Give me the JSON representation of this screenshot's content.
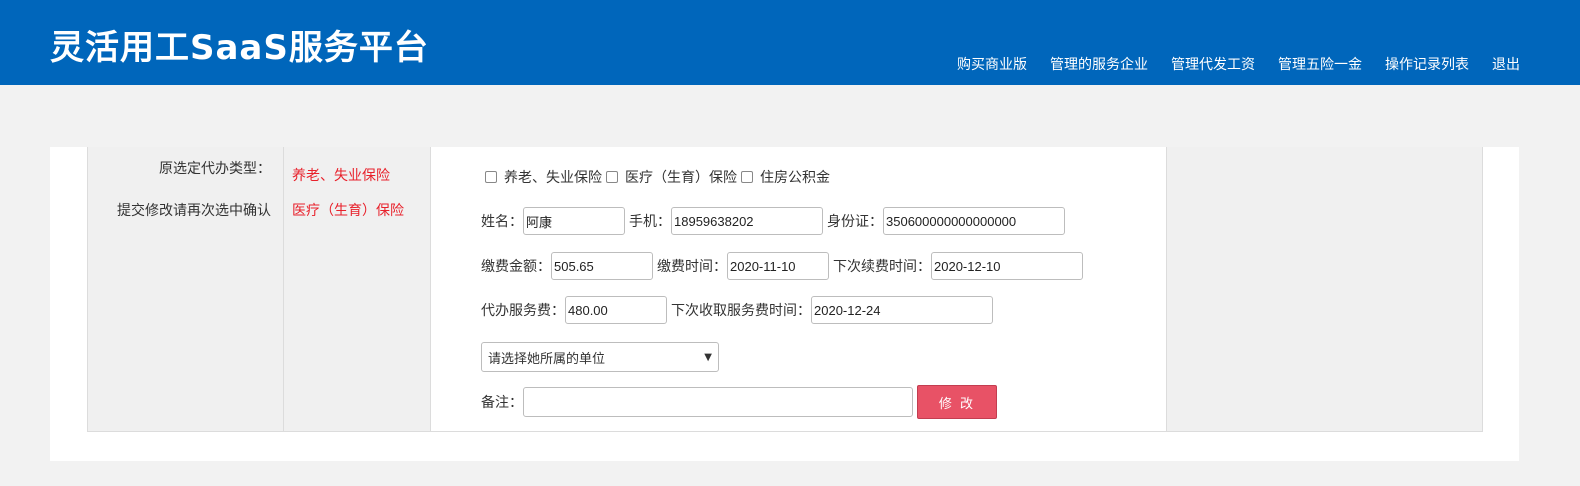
{
  "header": {
    "title": "灵活用工SaaS服务平台",
    "nav": [
      "购买商业版",
      "管理的服务企业",
      "管理代发工资",
      "管理五险一金",
      "操作记录列表",
      "退出"
    ]
  },
  "left": {
    "label1": "原选定代办类型：",
    "label2": "提交修改请再次选中确认"
  },
  "original_types": [
    "养老、失业保险",
    "医疗（生育）保险"
  ],
  "form": {
    "checkboxes": [
      "养老、失业保险",
      "医疗（生育）保险",
      "住房公积金"
    ],
    "name_label": "姓名：",
    "name_value": "阿康",
    "phone_label": "手机：",
    "phone_value": "18959638202",
    "id_label": "身份证：",
    "id_value": "350600000000000000",
    "pay_amount_label": "缴费金额：",
    "pay_amount_value": "505.65",
    "pay_time_label": "缴费时间：",
    "pay_time_value": "2020-11-10",
    "next_renew_label": "下次续费时间：",
    "next_renew_value": "2020-12-10",
    "service_fee_label": "代办服务费：",
    "service_fee_value": "480.00",
    "next_fee_label": "下次收取服务费时间：",
    "next_fee_value": "2020-12-24",
    "unit_select": "请选择她所属的单位",
    "remark_label": "备注：",
    "remark_value": "",
    "submit_label": "修 改"
  },
  "colors": {
    "header": "#0066bb",
    "red_text": "#e8212b",
    "button": "#e85266"
  }
}
